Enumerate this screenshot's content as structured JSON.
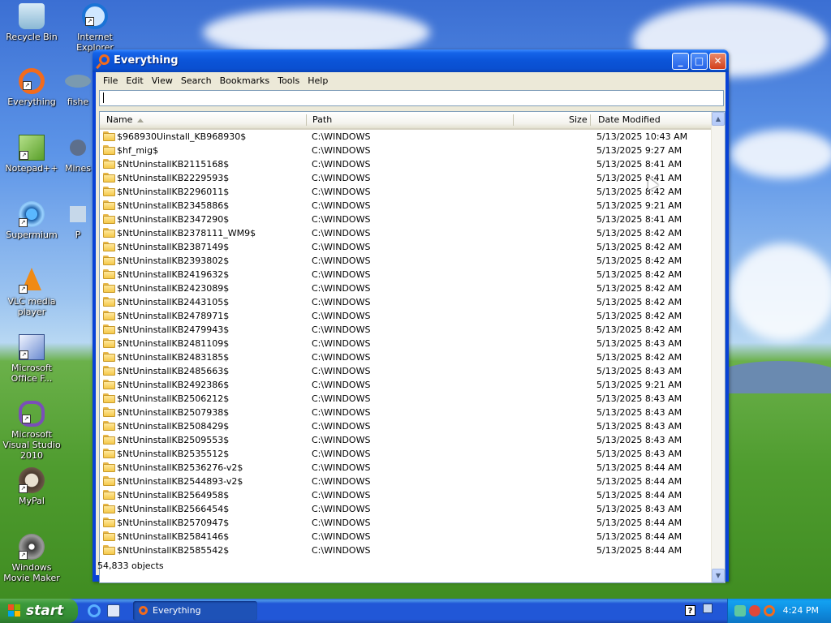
{
  "desktop": {
    "icons": [
      {
        "label": "Recycle Bin"
      },
      {
        "label": "Internet Explorer"
      },
      {
        "label": "Everything"
      },
      {
        "label": "fishe"
      },
      {
        "label": "Notepad++"
      },
      {
        "label": "Mines"
      },
      {
        "label": "Supermium"
      },
      {
        "label": "P"
      },
      {
        "label": "VLC media player"
      },
      {
        "label": "Microsoft Office F..."
      },
      {
        "label": "Microsoft Visual Studio 2010"
      },
      {
        "label": "MyPal"
      },
      {
        "label": "Windows Movie Maker"
      }
    ]
  },
  "window": {
    "title": "Everything",
    "buttons": {
      "minimize": "_",
      "maximize": "□",
      "close": "✕"
    },
    "menu": [
      "File",
      "Edit",
      "View",
      "Search",
      "Bookmarks",
      "Tools",
      "Help"
    ],
    "search": {
      "value": ""
    },
    "columns": {
      "name": "Name",
      "path": "Path",
      "size": "Size",
      "date": "Date Modified"
    },
    "rows": [
      {
        "name": "$968930Uinstall_KB968930$",
        "path": "C:\\WINDOWS",
        "date": "5/13/2025 10:43 AM"
      },
      {
        "name": "$hf_mig$",
        "path": "C:\\WINDOWS",
        "date": "5/13/2025 9:27 AM"
      },
      {
        "name": "$NtUninstallKB2115168$",
        "path": "C:\\WINDOWS",
        "date": "5/13/2025 8:41 AM"
      },
      {
        "name": "$NtUninstallKB2229593$",
        "path": "C:\\WINDOWS",
        "date": "5/13/2025 8:41 AM"
      },
      {
        "name": "$NtUninstallKB2296011$",
        "path": "C:\\WINDOWS",
        "date": "5/13/2025 8:42 AM"
      },
      {
        "name": "$NtUninstallKB2345886$",
        "path": "C:\\WINDOWS",
        "date": "5/13/2025 9:21 AM"
      },
      {
        "name": "$NtUninstallKB2347290$",
        "path": "C:\\WINDOWS",
        "date": "5/13/2025 8:41 AM"
      },
      {
        "name": "$NtUninstallKB2378111_WM9$",
        "path": "C:\\WINDOWS",
        "date": "5/13/2025 8:42 AM"
      },
      {
        "name": "$NtUninstallKB2387149$",
        "path": "C:\\WINDOWS",
        "date": "5/13/2025 8:42 AM"
      },
      {
        "name": "$NtUninstallKB2393802$",
        "path": "C:\\WINDOWS",
        "date": "5/13/2025 8:42 AM"
      },
      {
        "name": "$NtUninstallKB2419632$",
        "path": "C:\\WINDOWS",
        "date": "5/13/2025 8:42 AM"
      },
      {
        "name": "$NtUninstallKB2423089$",
        "path": "C:\\WINDOWS",
        "date": "5/13/2025 8:42 AM"
      },
      {
        "name": "$NtUninstallKB2443105$",
        "path": "C:\\WINDOWS",
        "date": "5/13/2025 8:42 AM"
      },
      {
        "name": "$NtUninstallKB2478971$",
        "path": "C:\\WINDOWS",
        "date": "5/13/2025 8:42 AM"
      },
      {
        "name": "$NtUninstallKB2479943$",
        "path": "C:\\WINDOWS",
        "date": "5/13/2025 8:42 AM"
      },
      {
        "name": "$NtUninstallKB2481109$",
        "path": "C:\\WINDOWS",
        "date": "5/13/2025 8:43 AM"
      },
      {
        "name": "$NtUninstallKB2483185$",
        "path": "C:\\WINDOWS",
        "date": "5/13/2025 8:42 AM"
      },
      {
        "name": "$NtUninstallKB2485663$",
        "path": "C:\\WINDOWS",
        "date": "5/13/2025 8:43 AM"
      },
      {
        "name": "$NtUninstallKB2492386$",
        "path": "C:\\WINDOWS",
        "date": "5/13/2025 9:21 AM"
      },
      {
        "name": "$NtUninstallKB2506212$",
        "path": "C:\\WINDOWS",
        "date": "5/13/2025 8:43 AM"
      },
      {
        "name": "$NtUninstallKB2507938$",
        "path": "C:\\WINDOWS",
        "date": "5/13/2025 8:43 AM"
      },
      {
        "name": "$NtUninstallKB2508429$",
        "path": "C:\\WINDOWS",
        "date": "5/13/2025 8:43 AM"
      },
      {
        "name": "$NtUninstallKB2509553$",
        "path": "C:\\WINDOWS",
        "date": "5/13/2025 8:43 AM"
      },
      {
        "name": "$NtUninstallKB2535512$",
        "path": "C:\\WINDOWS",
        "date": "5/13/2025 8:43 AM"
      },
      {
        "name": "$NtUninstallKB2536276-v2$",
        "path": "C:\\WINDOWS",
        "date": "5/13/2025 8:44 AM"
      },
      {
        "name": "$NtUninstallKB2544893-v2$",
        "path": "C:\\WINDOWS",
        "date": "5/13/2025 8:44 AM"
      },
      {
        "name": "$NtUninstallKB2564958$",
        "path": "C:\\WINDOWS",
        "date": "5/13/2025 8:44 AM"
      },
      {
        "name": "$NtUninstallKB2566454$",
        "path": "C:\\WINDOWS",
        "date": "5/13/2025 8:43 AM"
      },
      {
        "name": "$NtUninstallKB2570947$",
        "path": "C:\\WINDOWS",
        "date": "5/13/2025 8:44 AM"
      },
      {
        "name": "$NtUninstallKB2584146$",
        "path": "C:\\WINDOWS",
        "date": "5/13/2025 8:44 AM"
      },
      {
        "name": "$NtUninstallKB2585542$",
        "path": "C:\\WINDOWS",
        "date": "5/13/2025 8:44 AM"
      }
    ],
    "status": "54,833 objects"
  },
  "taskbar": {
    "start_label": "start",
    "task_label": "Everything",
    "clock": "4:24 PM"
  },
  "colors": {
    "title_bar": "#0b54d8",
    "start_button": "#3c9a3c",
    "taskbar": "#2157d7",
    "tray": "#0f8ee1",
    "accent_orange": "#f26b1d"
  },
  "icons": {
    "app": "magnifier-icon",
    "folder": "folder-icon",
    "sort": "sort-ascending-icon"
  }
}
